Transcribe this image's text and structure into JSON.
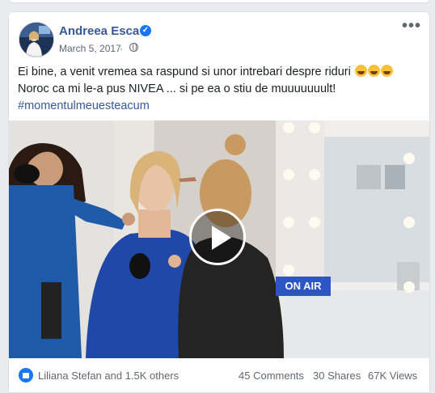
{
  "post": {
    "author": "Andreea Esca",
    "date": "March 5, 2017",
    "separator": "·",
    "more_label": "•••",
    "text_line1": "Ei bine, a venit vremea sa raspund si unor intrebari despre riduri",
    "text_line2": "Noroc ca mi le-a pus NIVEA ... si pe ea o stiu de muuuuuuult!",
    "hashtag": "#momentulmeuesteacum",
    "emoji_count": 3
  },
  "video": {
    "sign_text": "ON AIR"
  },
  "stats": {
    "likes": "Liliana Stefan and 1.5K others",
    "comments": "45 Comments",
    "shares": "30 Shares",
    "views": "67K Views"
  },
  "colors": {
    "brand": "#385898",
    "verified": "#1877f2",
    "secondary_text": "#606770"
  },
  "icons": [
    "verified-badge-icon",
    "globe-icon",
    "more-options-icon",
    "play-icon",
    "like-reaction-icon"
  ]
}
